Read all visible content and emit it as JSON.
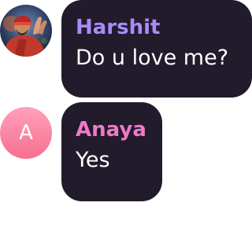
{
  "colors": {
    "bubble_bg": "#211b2b",
    "message_text": "#ffffff",
    "accent_harshit": "#a78bfa",
    "accent_anaya": "#ee79c7",
    "avatar_anaya_gradient_top": "#ffa0bd",
    "avatar_anaya_gradient_bottom": "#f7708e"
  },
  "messages": [
    {
      "sender": "Harshit",
      "text": "Do u love me?",
      "avatar": {
        "type": "photo",
        "icon": "user-photo-icon"
      }
    },
    {
      "sender": "Anaya",
      "text": "Yes",
      "avatar": {
        "type": "initial",
        "initial": "A"
      }
    }
  ]
}
